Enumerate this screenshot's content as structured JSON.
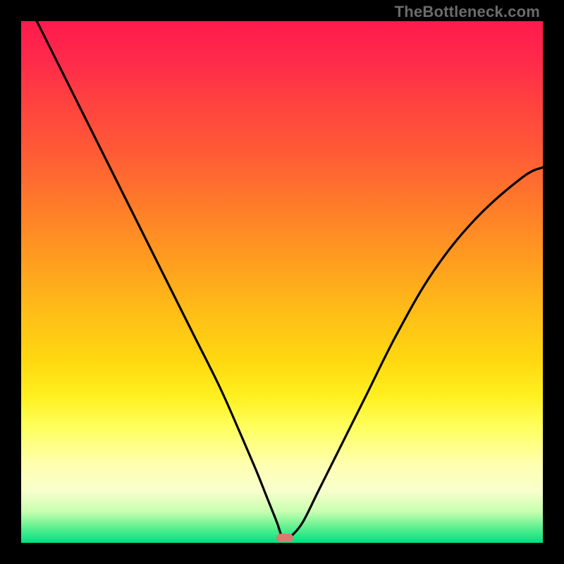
{
  "watermark": "TheBottleneck.com",
  "chart_data": {
    "type": "line",
    "title": "",
    "xlabel": "",
    "ylabel": "",
    "xlim": [
      0,
      100
    ],
    "ylim": [
      0,
      100
    ],
    "series": [
      {
        "name": "bottleneck-curve",
        "x": [
          3,
          8,
          13,
          18,
          23,
          28,
          33,
          38,
          42,
          45,
          47,
          49,
          50,
          51,
          52,
          54,
          57,
          61,
          66,
          72,
          79,
          87,
          96,
          100
        ],
        "y": [
          100,
          90,
          80,
          70,
          60,
          50,
          40,
          30,
          21,
          14,
          9,
          4,
          1.2,
          0.8,
          1.5,
          4,
          10,
          18,
          28,
          40,
          52,
          62,
          70,
          72
        ]
      }
    ],
    "marker": {
      "x": 50.5,
      "y": 0.9,
      "color": "#d77a6f"
    },
    "background_gradient": {
      "top": "#ff1a4d",
      "mid": "#ffd810",
      "bottom": "#00e080"
    }
  }
}
